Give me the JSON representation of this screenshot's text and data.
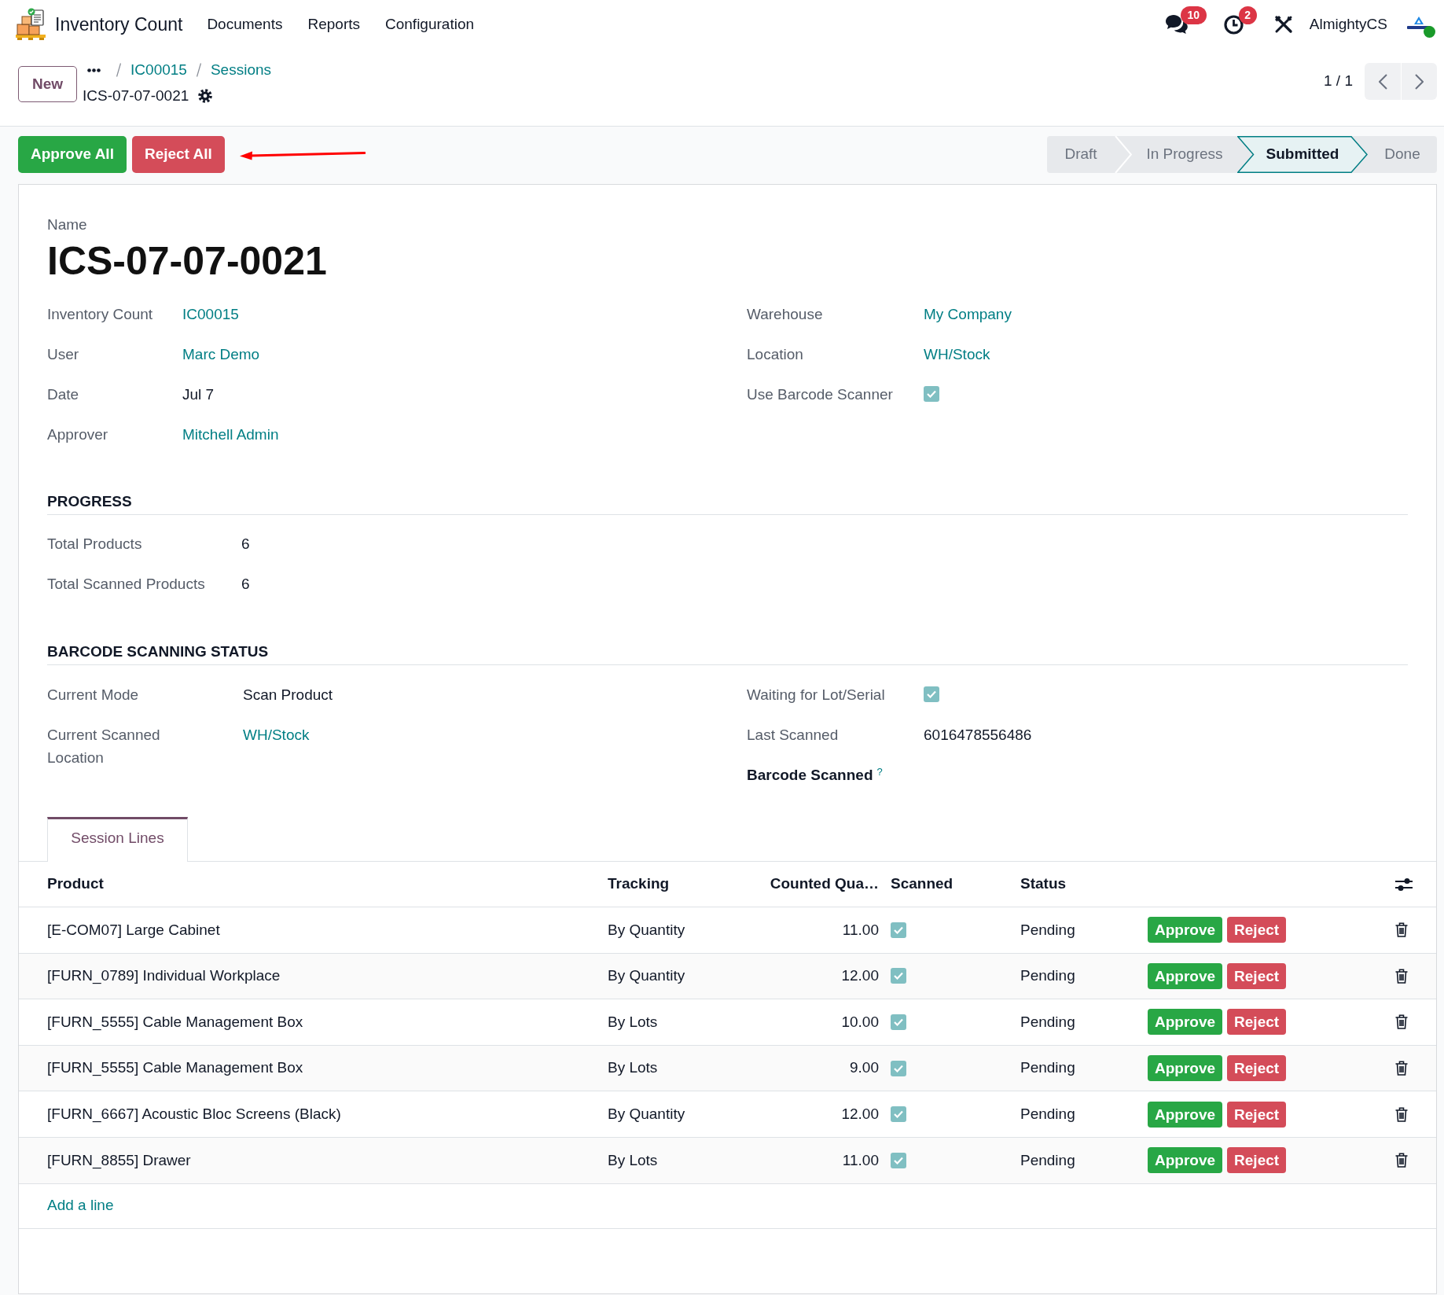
{
  "navbar": {
    "app_name": "Inventory Count",
    "menus": [
      {
        "label": "Documents"
      },
      {
        "label": "Reports"
      },
      {
        "label": "Configuration"
      }
    ],
    "messages_count": "10",
    "activities_count": "2",
    "user_name": "AlmightyCS"
  },
  "breadcrumbs": {
    "new_button": "New",
    "items": [
      {
        "label": "IC00015"
      },
      {
        "label": "Sessions"
      }
    ],
    "current": "ICS-07-07-0021"
  },
  "pager": {
    "text": "1 / 1"
  },
  "actions": [
    {
      "label": "Approve All",
      "kind": "approve"
    },
    {
      "label": "Reject All",
      "kind": "reject"
    }
  ],
  "status_bar": [
    {
      "label": "Draft",
      "selected": false
    },
    {
      "label": "In Progress",
      "selected": false
    },
    {
      "label": "Submitted",
      "selected": true
    },
    {
      "label": "Done",
      "selected": false
    }
  ],
  "form": {
    "name_label": "Name",
    "name": "ICS-07-07-0021",
    "main_fields": {
      "left": [
        {
          "label": "Inventory Count",
          "kind": "link",
          "value": "IC00015"
        },
        {
          "label": "User",
          "kind": "link",
          "value": "Marc Demo"
        },
        {
          "label": "Date",
          "kind": "text",
          "value": "Jul 7"
        },
        {
          "label": "Approver",
          "kind": "link",
          "value": "Mitchell Admin"
        }
      ],
      "right": [
        {
          "label": "Warehouse",
          "kind": "link",
          "value": "My Company"
        },
        {
          "label": "Location",
          "kind": "link",
          "value": "WH/Stock"
        },
        {
          "label": "Use Barcode Scanner",
          "kind": "checkbox",
          "checked": true
        }
      ]
    },
    "sections": [
      {
        "title": "PROGRESS",
        "left": [
          {
            "label": "Total Products",
            "kind": "text",
            "value": "6"
          },
          {
            "label": "Total Scanned Products",
            "kind": "text",
            "value": "6"
          }
        ]
      },
      {
        "title": "BARCODE SCANNING STATUS",
        "left": [
          {
            "label": "Current Mode",
            "kind": "text",
            "value": "Scan Product"
          },
          {
            "label": "Current Scanned Location",
            "kind": "link",
            "value": "WH/Stock"
          }
        ],
        "right": [
          {
            "label": "Waiting for Lot/Serial",
            "kind": "checkbox",
            "checked": true
          },
          {
            "label": "Last Scanned",
            "kind": "text",
            "value": "6016478556486"
          },
          {
            "label": "Barcode Scanned",
            "kind": "label_only",
            "help": "?"
          }
        ]
      }
    ]
  },
  "tabs": [
    {
      "label": "Session Lines",
      "selected": true
    }
  ],
  "table": {
    "columns": [
      {
        "label": "Product",
        "kind": "text"
      },
      {
        "label": "Tracking",
        "kind": "text"
      },
      {
        "label": "Counted Qua…",
        "kind": "number"
      },
      {
        "label": "Scanned",
        "kind": "check"
      },
      {
        "label": "Status",
        "kind": "text"
      }
    ],
    "rows": [
      {
        "product": "[E-COM07] Large Cabinet",
        "tracking": "By Quantity",
        "counted_quantity": "11.00",
        "scanned": true,
        "status": "Pending",
        "buttons": [
          {
            "label": "Approve",
            "kind": "approve"
          },
          {
            "label": "Reject",
            "kind": "reject"
          }
        ]
      },
      {
        "product": "[FURN_0789] Individual Workplace",
        "tracking": "By Quantity",
        "counted_quantity": "12.00",
        "scanned": true,
        "status": "Pending",
        "buttons": [
          {
            "label": "Approve",
            "kind": "approve"
          },
          {
            "label": "Reject",
            "kind": "reject"
          }
        ]
      },
      {
        "product": "[FURN_5555] Cable Management Box",
        "tracking": "By Lots",
        "counted_quantity": "10.00",
        "scanned": true,
        "status": "Pending",
        "buttons": [
          {
            "label": "Approve",
            "kind": "approve"
          },
          {
            "label": "Reject",
            "kind": "reject"
          }
        ]
      },
      {
        "product": "[FURN_5555] Cable Management Box",
        "tracking": "By Lots",
        "counted_quantity": "9.00",
        "scanned": true,
        "status": "Pending",
        "buttons": [
          {
            "label": "Approve",
            "kind": "approve"
          },
          {
            "label": "Reject",
            "kind": "reject"
          }
        ]
      },
      {
        "product": "[FURN_6667] Acoustic Bloc Screens (Black)",
        "tracking": "By Quantity",
        "counted_quantity": "12.00",
        "scanned": true,
        "status": "Pending",
        "buttons": [
          {
            "label": "Approve",
            "kind": "approve"
          },
          {
            "label": "Reject",
            "kind": "reject"
          }
        ]
      },
      {
        "product": "[FURN_8855] Drawer",
        "tracking": "By Lots",
        "counted_quantity": "11.00",
        "scanned": true,
        "status": "Pending",
        "buttons": [
          {
            "label": "Approve",
            "kind": "approve"
          },
          {
            "label": "Reject",
            "kind": "reject"
          }
        ]
      }
    ],
    "add_line": "Add a line"
  }
}
